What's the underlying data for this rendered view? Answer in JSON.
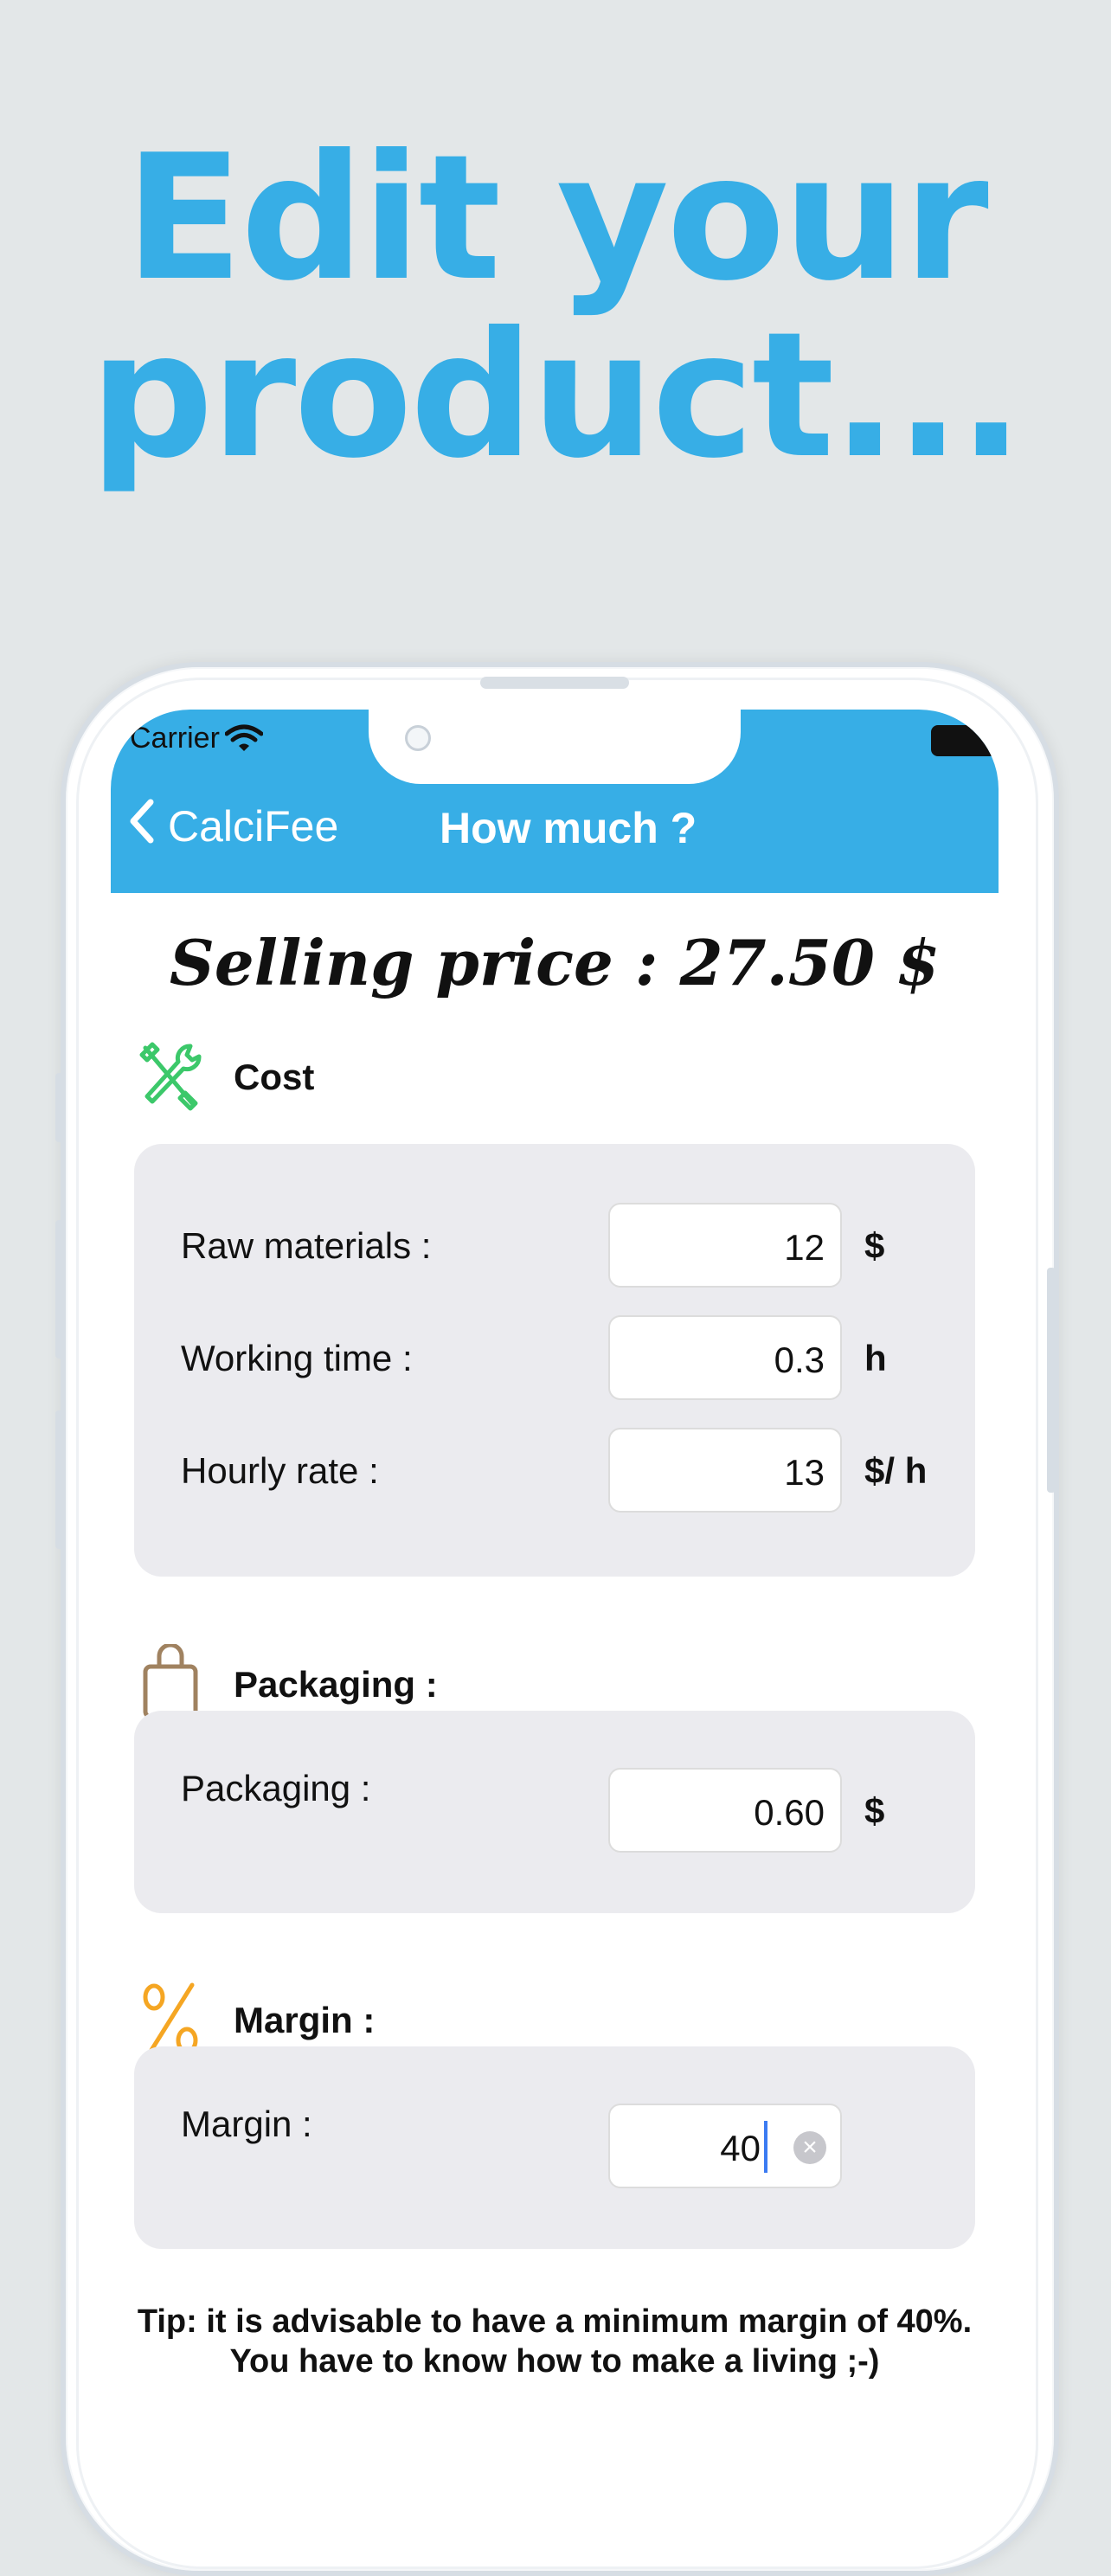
{
  "headline": {
    "line1": "Edit your",
    "line2": "product..."
  },
  "status_bar": {
    "carrier": "Carrier"
  },
  "nav": {
    "back_label": "CalciFee",
    "title": "How much ?"
  },
  "selling_price": "Selling price : 27.50 $",
  "cost": {
    "title": "Cost",
    "icon": "tools-icon",
    "rows": [
      {
        "label": "Raw materials :",
        "value": "12",
        "unit": "$"
      },
      {
        "label": "Working time :",
        "value": "0.3",
        "unit": "h"
      },
      {
        "label": "Hourly rate :",
        "value": "13",
        "unit": "$/ h"
      }
    ]
  },
  "packaging": {
    "title": "Packaging :",
    "icon": "bag-icon",
    "rows": [
      {
        "label": "Packaging :",
        "value": "0.60",
        "unit": "$"
      }
    ]
  },
  "margin": {
    "title": "Margin :",
    "icon": "percent-icon",
    "rows": [
      {
        "label": "Margin :",
        "value": "40"
      }
    ]
  },
  "tip": {
    "line1": "Tip: it is advisable to have a minimum margin of 40%.",
    "line2": "You have to know how to make a living ;-)"
  },
  "colors": {
    "accent": "#37aee6",
    "background": "#e3e7e8",
    "card": "#ebebef"
  }
}
